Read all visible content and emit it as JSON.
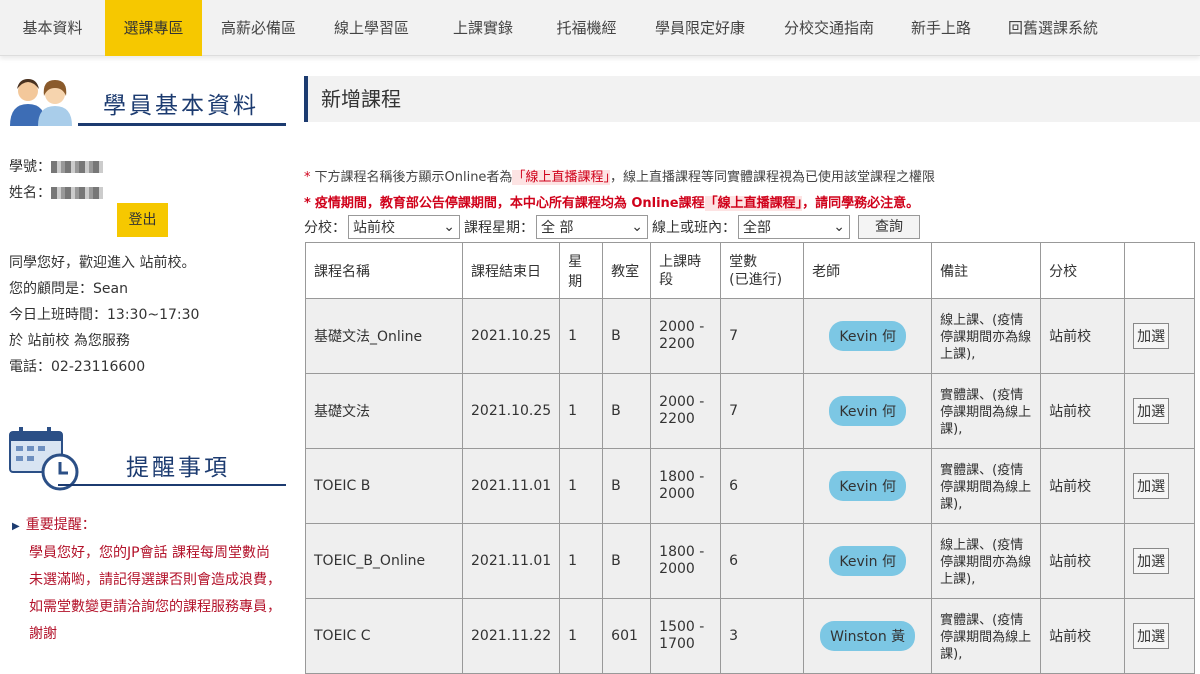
{
  "nav": [
    "基本資料",
    "選課專區",
    "高薪必備區",
    "線上學習區",
    "上課實錄",
    "托福機經",
    "學員限定好康",
    "分校交通指南",
    "新手上路",
    "回舊選課系統"
  ],
  "sidebar": {
    "title": "學員基本資料",
    "student_id_label": "學號：",
    "name_label": "姓名：",
    "logout": "登出",
    "welcome": "同學您好，歡迎進入 站前校。",
    "advisor": "您的顧問是：Sean",
    "hours": "今日上班時間：13:30~17:30",
    "serve": "於 站前校 為您服務",
    "phone": "電話：02-23116600"
  },
  "reminder": {
    "title": "提醒事項",
    "heading": "重要提醒：",
    "body": "學員您好，您的JP會話 課程每周堂數尚未選滿喲，請記得選課否則會造成浪費，如需堂數變更請洽詢您的課程服務專員，謝謝"
  },
  "main": {
    "title": "新增課程",
    "note1_prefix": "下方課程名稱後方顯示Online者為",
    "note1_highlight": "「線上直播課程」",
    "note1_suffix": "，線上直播課程等同實體課程視為已使用該堂課程之權限",
    "note2_prefix": "疫情期間，教育部公告停課期間，本中心所有課程均為 Online課程",
    "note2_highlight": "「線上直播課程」",
    "note2_suffix": "，請同學務必注意。",
    "filters": {
      "branch_label": "分校：",
      "branch_value": "站前校",
      "weekday_label": "課程星期：",
      "weekday_value": "全 部",
      "mode_label": "線上或班內：",
      "mode_value": "全部",
      "search": "查詢"
    },
    "headers": [
      "課程名稱",
      "課程結束日",
      "星期",
      "教室",
      "上課時段",
      "堂數\n(已進行)",
      "老師",
      "備註",
      "分校",
      ""
    ],
    "rows": [
      {
        "name": "基礎文法_Online",
        "end": "2021.10.25",
        "day": "1",
        "room": "B",
        "time": "2000 -\n2200",
        "count": "7",
        "teacher": "Kevin 何",
        "remark": "線上課、(疫情停課期間亦為線上課),",
        "branch": "站前校",
        "action": "加選"
      },
      {
        "name": "基礎文法",
        "end": "2021.10.25",
        "day": "1",
        "room": "B",
        "time": "2000 -\n2200",
        "count": "7",
        "teacher": "Kevin 何",
        "remark": "實體課、(疫情停課期間為線上課),",
        "branch": "站前校",
        "action": "加選"
      },
      {
        "name": "TOEIC B",
        "end": "2021.11.01",
        "day": "1",
        "room": "B",
        "time": "1800 -\n2000",
        "count": "6",
        "teacher": "Kevin 何",
        "remark": "實體課、(疫情停課期間為線上課),",
        "branch": "站前校",
        "action": "加選"
      },
      {
        "name": "TOEIC_B_Online",
        "end": "2021.11.01",
        "day": "1",
        "room": "B",
        "time": "1800 -\n2000",
        "count": "6",
        "teacher": "Kevin 何",
        "remark": "線上課、(疫情停課期間亦為線上課),",
        "branch": "站前校",
        "action": "加選"
      },
      {
        "name": "TOEIC C",
        "end": "2021.11.22",
        "day": "1",
        "room": "601",
        "time": "1500 -\n1700",
        "count": "3",
        "teacher": "Winston 黃",
        "remark": "實體課、(疫情停課期間為線上課),",
        "branch": "站前校",
        "action": "加選"
      }
    ]
  },
  "colors": {
    "accent": "#f6c800",
    "brand": "#1c3b70",
    "warning": "#d0021b",
    "teacher_pill": "#7cc7e4"
  }
}
